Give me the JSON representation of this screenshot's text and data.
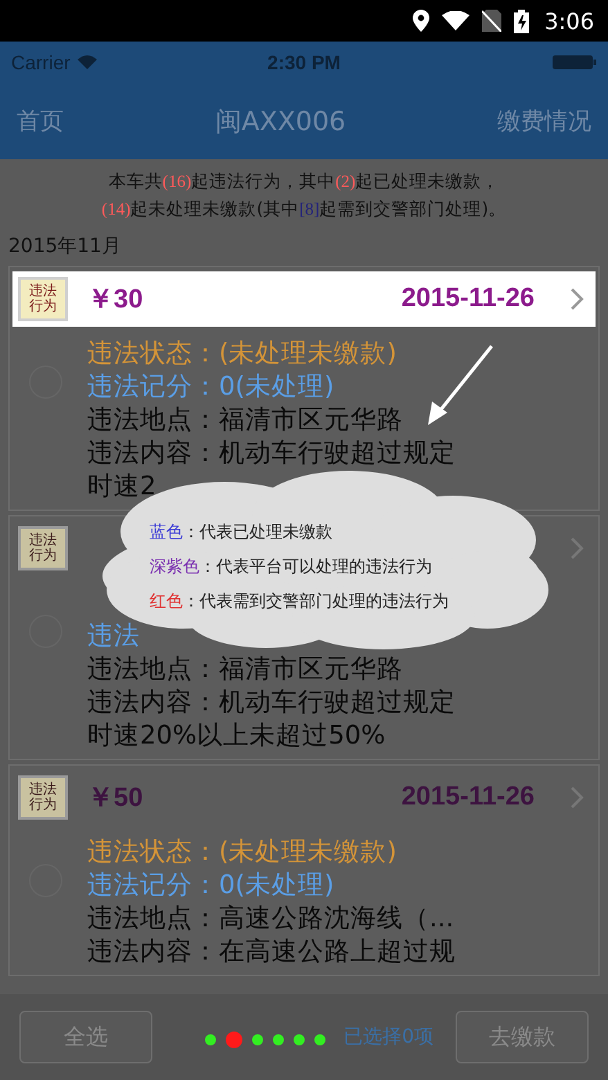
{
  "device_status_bar": {
    "time": "3:06"
  },
  "app_status_bar": {
    "carrier": "Carrier",
    "time": "2:30 PM"
  },
  "nav_bar": {
    "left": "首页",
    "title": "闽AXX006",
    "right": "缴费情况"
  },
  "summary": {
    "lines": [
      [
        {
          "kind": "text",
          "text": "本车共"
        },
        {
          "kind": "count",
          "text": "(16)"
        },
        {
          "kind": "text",
          "text": "起违法行为，其中"
        },
        {
          "kind": "count",
          "text": "(2)"
        },
        {
          "kind": "text",
          "text": "起已处理未缴款，"
        }
      ],
      [
        {
          "kind": "count",
          "text": "(14)"
        },
        {
          "kind": "text",
          "text": "起未处理未缴款(其中"
        },
        {
          "kind": "referral",
          "text": "[8]"
        },
        {
          "kind": "text",
          "text": "起需到交警部门处理)。"
        }
      ]
    ]
  },
  "month": "2015年11月",
  "cards": [
    {
      "badge": "违法行为",
      "amount": "￥30",
      "date": "2015-11-26",
      "highlighted": true,
      "selected": false,
      "lines": [
        {
          "kind": "status",
          "text": "违法状态：(未处理未缴款)"
        },
        {
          "kind": "points",
          "text": "违法记分：0(未处理)"
        },
        {
          "kind": "plain",
          "text": "违法地点：福清市区元华路"
        },
        {
          "kind": "plain",
          "text": "违法内容：机动车行驶超过规定"
        },
        {
          "kind": "plain",
          "text": "时速2"
        }
      ]
    },
    {
      "badge": "违法行为",
      "highlighted": false,
      "selected": false,
      "lines": [
        {
          "kind": "points",
          "text": "违法"
        },
        {
          "kind": "plain",
          "text": "违法地点：福清市区元华路"
        },
        {
          "kind": "plain",
          "text": "违法内容：机动车行驶超过规定"
        },
        {
          "kind": "plain",
          "text": "时速20%以上未超过50%"
        }
      ]
    },
    {
      "badge": "违法行为",
      "amount": "￥50",
      "date": "2015-11-26",
      "highlighted": false,
      "selected": false,
      "lines": [
        {
          "kind": "status",
          "text": "违法状态：(未处理未缴款)"
        },
        {
          "kind": "points",
          "text": "违法记分：0(未处理)"
        },
        {
          "kind": "plain",
          "text": "违法地点：高速公路沈海线（..."
        },
        {
          "kind": "plain",
          "text": "违法内容：在高速公路上超过规"
        }
      ]
    }
  ],
  "legend": [
    {
      "term": "蓝色",
      "color": "#3b3bd6",
      "text": "：代表已处理未缴款"
    },
    {
      "term": "深紫色",
      "color": "#7a2fb0",
      "text": "：代表平台可以处理的违法行为"
    },
    {
      "term": "红色",
      "color": "#e03030",
      "text": "：代表需到交警部门处理的违法行为"
    }
  ],
  "bottom_bar": {
    "select_all": "全选",
    "selected_count": "已选择0项",
    "pay": "去缴款"
  },
  "page_dots": [
    {
      "selected": false
    },
    {
      "selected": true
    },
    {
      "selected": false
    },
    {
      "selected": false
    },
    {
      "selected": false
    },
    {
      "selected": false
    }
  ]
}
